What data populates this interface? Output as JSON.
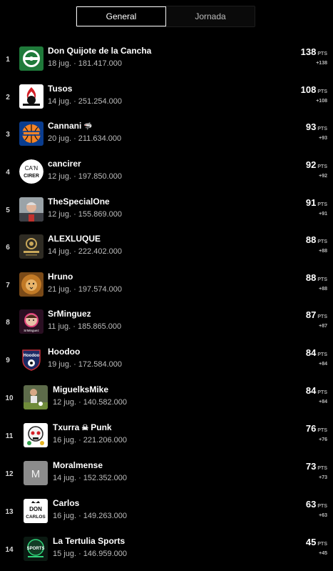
{
  "tabs": [
    {
      "label": "General",
      "active": true
    },
    {
      "label": "Jornada",
      "active": false
    }
  ],
  "points_label": "PTS",
  "rows": [
    {
      "rank": "1",
      "name": "Don Quijote de la Cancha",
      "meta": "18 jug. · 181.417.000",
      "points": "138",
      "delta": "+138",
      "avatar_icon": "green-crest-icon"
    },
    {
      "rank": "2",
      "name": "Tusos",
      "meta": "14 jug. · 251.254.000",
      "points": "108",
      "delta": "+108",
      "avatar_icon": "red-crest-icon"
    },
    {
      "rank": "3",
      "name": "Cannani",
      "name_suffix": "🦈",
      "meta": "20 jug. · 211.634.000",
      "points": "93",
      "delta": "+93",
      "avatar_icon": "knicks-logo-icon"
    },
    {
      "rank": "4",
      "name": "cancirer",
      "meta": "12 jug. · 197.850.000",
      "points": "92",
      "delta": "+92",
      "avatar_icon": "ca-n-cirer-logo-icon",
      "avatar_text_top": "CA'N",
      "avatar_text_bottom": "CIRER"
    },
    {
      "rank": "5",
      "name": "TheSpecialOne",
      "meta": "12 jug. · 155.869.000",
      "points": "91",
      "delta": "+91",
      "avatar_icon": "person-photo-icon"
    },
    {
      "rank": "6",
      "name": "ALEXLUQUE",
      "meta": "14 jug. · 222.402.000",
      "points": "88",
      "delta": "+88",
      "avatar_icon": "gold-emblem-icon"
    },
    {
      "rank": "7",
      "name": "Hruno",
      "meta": "21 jug. · 197.574.000",
      "points": "88",
      "delta": "+88",
      "avatar_icon": "lion-icon"
    },
    {
      "rank": "8",
      "name": "SrMinguez",
      "meta": "11 jug. · 185.865.000",
      "points": "87",
      "delta": "+87",
      "avatar_icon": "cartoon-avatar-icon",
      "avatar_text": "SrMinguez"
    },
    {
      "rank": "9",
      "name": "Hoodoo",
      "meta": "19 jug. · 172.584.000",
      "points": "84",
      "delta": "+84",
      "avatar_icon": "hoodoo-shield-icon",
      "avatar_text": "Hoodoo"
    },
    {
      "rank": "10",
      "name": "MiguelksMike",
      "meta": "12 jug. · 140.582.000",
      "points": "84",
      "delta": "+84",
      "avatar_icon": "player-photo-icon"
    },
    {
      "rank": "11",
      "name": "Txurra",
      "name_mid": "☠",
      "name_after": "Punk",
      "meta": "16 jug. · 221.206.000",
      "points": "76",
      "delta": "+76",
      "avatar_icon": "skull-mascot-icon"
    },
    {
      "rank": "12",
      "name": "Moralmense",
      "meta": "14 jug. · 152.352.000",
      "points": "73",
      "delta": "+73",
      "avatar_icon": "letter-m-icon",
      "avatar_text": "M"
    },
    {
      "rank": "13",
      "name": "Carlos",
      "meta": "16 jug. · 149.263.000",
      "points": "63",
      "delta": "+63",
      "avatar_icon": "don-carlos-logo-icon",
      "avatar_text_top": "DON",
      "avatar_text_bottom": "CARLOS"
    },
    {
      "rank": "14",
      "name": "La Tertulia Sports",
      "meta": "15 jug. · 146.959.000",
      "points": "45",
      "delta": "+45",
      "avatar_icon": "tertulia-sports-logo-icon",
      "avatar_text": "SPORTS"
    }
  ]
}
